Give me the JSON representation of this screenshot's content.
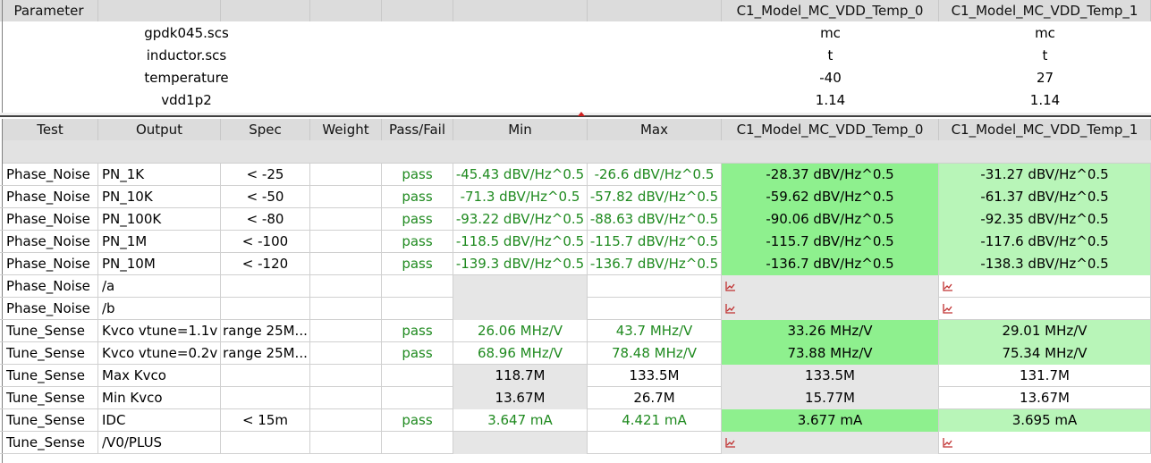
{
  "param_table": {
    "headers": [
      "Parameter",
      "",
      "",
      "",
      "",
      "",
      "",
      "C1_Model_MC_VDD_Temp_0",
      "C1_Model_MC_VDD_Temp_1"
    ],
    "rows": [
      {
        "name": "gpdk045.scs",
        "v0": "mc",
        "v1": "mc"
      },
      {
        "name": "inductor.scs",
        "v0": "t",
        "v1": "t"
      },
      {
        "name": "temperature",
        "v0": "-40",
        "v1": "27"
      },
      {
        "name": "vdd1p2",
        "v0": "1.14",
        "v1": "1.14"
      }
    ]
  },
  "results_table": {
    "headers": [
      "Test",
      "Output",
      "Spec",
      "Weight",
      "Pass/Fail",
      "Min",
      "Max",
      "C1_Model_MC_VDD_Temp_0",
      "C1_Model_MC_VDD_Temp_1"
    ],
    "rows": [
      {
        "test": "Phase_Noise",
        "output": "PN_1K",
        "spec": "< -25",
        "weight": "",
        "pf": "pass",
        "min": "-45.43 dBV/Hz^0.5",
        "max": "-26.6 dBV/Hz^0.5",
        "t0": "-28.37 dBV/Hz^0.5",
        "t1": "-31.27 dBV/Hz^0.5",
        "kind": "spec"
      },
      {
        "test": "Phase_Noise",
        "output": "PN_10K",
        "spec": "< -50",
        "weight": "",
        "pf": "pass",
        "min": "-71.3 dBV/Hz^0.5",
        "max": "-57.82 dBV/Hz^0.5",
        "t0": "-59.62 dBV/Hz^0.5",
        "t1": "-61.37 dBV/Hz^0.5",
        "kind": "spec"
      },
      {
        "test": "Phase_Noise",
        "output": "PN_100K",
        "spec": "< -80",
        "weight": "",
        "pf": "pass",
        "min": "-93.22 dBV/Hz^0.5",
        "max": "-88.63 dBV/Hz^0.5",
        "t0": "-90.06 dBV/Hz^0.5",
        "t1": "-92.35 dBV/Hz^0.5",
        "kind": "spec"
      },
      {
        "test": "Phase_Noise",
        "output": "PN_1M",
        "spec": "< -100",
        "weight": "",
        "pf": "pass",
        "min": "-118.5 dBV/Hz^0.5",
        "max": "-115.7 dBV/Hz^0.5",
        "t0": "-115.7 dBV/Hz^0.5",
        "t1": "-117.6 dBV/Hz^0.5",
        "kind": "spec"
      },
      {
        "test": "Phase_Noise",
        "output": "PN_10M",
        "spec": "< -120",
        "weight": "",
        "pf": "pass",
        "min": "-139.3 dBV/Hz^0.5",
        "max": "-136.7 dBV/Hz^0.5",
        "t0": "-136.7 dBV/Hz^0.5",
        "t1": "-138.3 dBV/Hz^0.5",
        "kind": "spec"
      },
      {
        "test": "Phase_Noise",
        "output": "/a",
        "spec": "",
        "weight": "",
        "pf": "",
        "min": "",
        "max": "",
        "t0": "",
        "t1": "",
        "kind": "wave"
      },
      {
        "test": "Phase_Noise",
        "output": "/b",
        "spec": "",
        "weight": "",
        "pf": "",
        "min": "",
        "max": "",
        "t0": "",
        "t1": "",
        "kind": "wave"
      },
      {
        "test": "Tune_Sense",
        "output": "Kvco vtune=1.1v",
        "spec": "range 25M...",
        "weight": "",
        "pf": "pass",
        "min": "26.06 MHz/V",
        "max": "43.7 MHz/V",
        "t0": "33.26 MHz/V",
        "t1": "29.01 MHz/V",
        "kind": "spec"
      },
      {
        "test": "Tune_Sense",
        "output": "Kvco vtune=0.2v",
        "spec": "range 25M...",
        "weight": "",
        "pf": "pass",
        "min": "68.96 MHz/V",
        "max": "78.48 MHz/V",
        "t0": "73.88 MHz/V",
        "t1": "75.34 MHz/V",
        "kind": "spec"
      },
      {
        "test": "Tune_Sense",
        "output": "Max Kvco",
        "spec": "",
        "weight": "",
        "pf": "",
        "min": "118.7M",
        "max": "133.5M",
        "t0": "133.5M",
        "t1": "131.7M",
        "kind": "plain"
      },
      {
        "test": "Tune_Sense",
        "output": "Min Kvco",
        "spec": "",
        "weight": "",
        "pf": "",
        "min": "13.67M",
        "max": "26.7M",
        "t0": "15.77M",
        "t1": "13.67M",
        "kind": "plain"
      },
      {
        "test": "Tune_Sense",
        "output": "IDC",
        "spec": "< 15m",
        "weight": "",
        "pf": "pass",
        "min": "3.647 mA",
        "max": "4.421 mA",
        "t0": "3.677 mA",
        "t1": "3.695 mA",
        "kind": "spec"
      },
      {
        "test": "Tune_Sense",
        "output": "/V0/PLUS",
        "spec": "",
        "weight": "",
        "pf": "",
        "min": "",
        "max": "",
        "t0": "",
        "t1": "",
        "kind": "wave"
      }
    ]
  },
  "icons": {
    "wave": "waveform-plot-icon",
    "splitter": "splitter-arrow-icon"
  },
  "colors": {
    "pass_text": "#1f8a1f",
    "pass_bg_col0": "#8ef08e",
    "pass_bg_col1": "#b8f5b8",
    "header_bg": "#dcdcdc",
    "empty_bg": "#e6e6e6"
  }
}
